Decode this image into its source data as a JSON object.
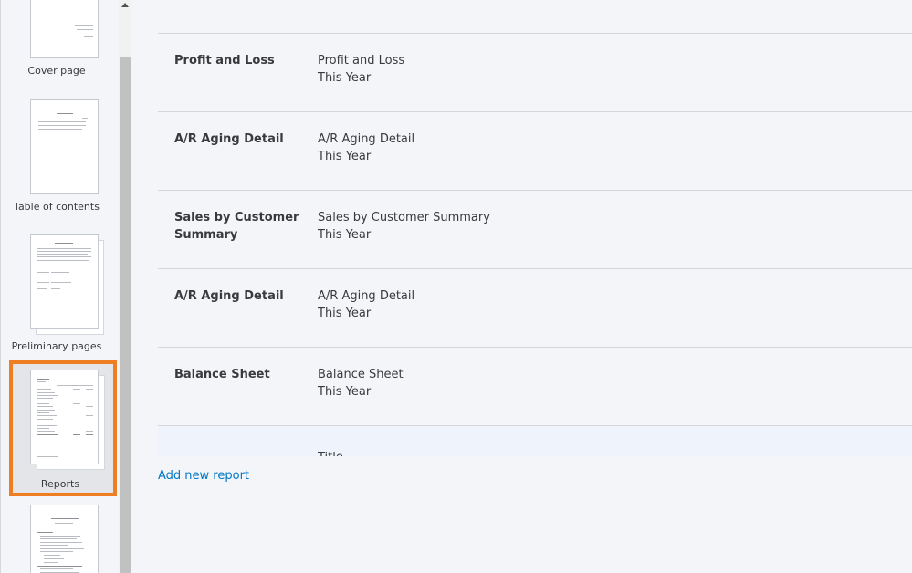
{
  "sidebar": {
    "items": [
      {
        "label": "Cover page"
      },
      {
        "label": "Table of contents"
      },
      {
        "label": "Preliminary pages"
      },
      {
        "label": "Reports",
        "selected": true
      },
      {
        "label": ""
      }
    ]
  },
  "reports": [
    {
      "name": "Profit and Loss",
      "title": "Profit and Loss",
      "period": "This Year"
    },
    {
      "name": "A/R Aging Detail",
      "title": "A/R Aging Detail",
      "period": "This Year"
    },
    {
      "name": "Sales by Customer Summary",
      "title": "Sales by Customer Summary",
      "period": "This Year"
    },
    {
      "name": "A/R Aging Detail",
      "title": "A/R Aging Detail",
      "period": "This Year"
    },
    {
      "name": "Balance Sheet",
      "title": "Balance Sheet",
      "period": "This Year"
    },
    {
      "name": "",
      "title": "Title",
      "period": ""
    }
  ],
  "add_report_label": "Add new report",
  "colors": {
    "accent": "#ef7d22",
    "link": "#0077c5",
    "background": "#f4f5f8"
  },
  "icons": {
    "scroll_up": "triangle-up"
  }
}
